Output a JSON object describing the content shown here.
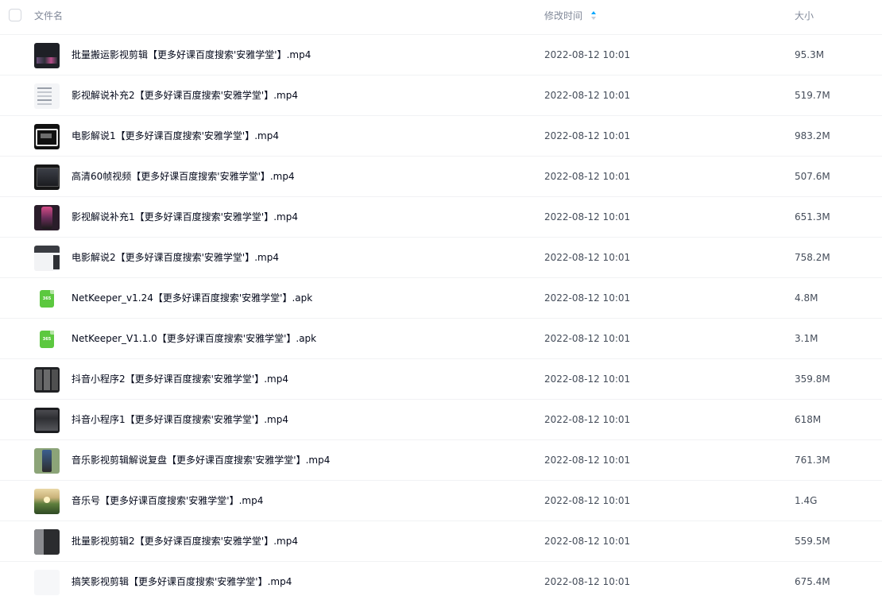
{
  "header": {
    "name_label": "文件名",
    "mtime_label": "修改时间",
    "size_label": "大小"
  },
  "files": [
    {
      "name": "批量搬运影视剪辑【更多好课百度搜索'安雅学堂'】.mp4",
      "mtime": "2022-08-12 10:01",
      "size": "95.3M",
      "type": "video"
    },
    {
      "name": "影视解说补充2【更多好课百度搜索'安雅学堂'】.mp4",
      "mtime": "2022-08-12 10:01",
      "size": "519.7M",
      "type": "video"
    },
    {
      "name": "电影解说1【更多好课百度搜索'安雅学堂'】.mp4",
      "mtime": "2022-08-12 10:01",
      "size": "983.2M",
      "type": "video"
    },
    {
      "name": "高清60帧视频【更多好课百度搜索'安雅学堂'】.mp4",
      "mtime": "2022-08-12 10:01",
      "size": "507.6M",
      "type": "video"
    },
    {
      "name": "影视解说补充1【更多好课百度搜索'安雅学堂'】.mp4",
      "mtime": "2022-08-12 10:01",
      "size": "651.3M",
      "type": "video"
    },
    {
      "name": "电影解说2【更多好课百度搜索'安雅学堂'】.mp4",
      "mtime": "2022-08-12 10:01",
      "size": "758.2M",
      "type": "video"
    },
    {
      "name": "NetKeeper_v1.24【更多好课百度搜索'安雅学堂'】.apk",
      "mtime": "2022-08-12 10:01",
      "size": "4.8M",
      "type": "apk"
    },
    {
      "name": "NetKeeper_V1.1.0【更多好课百度搜索'安雅学堂'】.apk",
      "mtime": "2022-08-12 10:01",
      "size": "3.1M",
      "type": "apk"
    },
    {
      "name": "抖音小程序2【更多好课百度搜索'安雅学堂'】.mp4",
      "mtime": "2022-08-12 10:01",
      "size": "359.8M",
      "type": "video"
    },
    {
      "name": "抖音小程序1【更多好课百度搜索'安雅学堂'】.mp4",
      "mtime": "2022-08-12 10:01",
      "size": "618M",
      "type": "video"
    },
    {
      "name": "音乐影视剪辑解说复盘【更多好课百度搜索'安雅学堂'】.mp4",
      "mtime": "2022-08-12 10:01",
      "size": "761.3M",
      "type": "video"
    },
    {
      "name": "音乐号【更多好课百度搜索'安雅学堂'】.mp4",
      "mtime": "2022-08-12 10:01",
      "size": "1.4G",
      "type": "video"
    },
    {
      "name": "批量影视剪辑2【更多好课百度搜索'安雅学堂'】.mp4",
      "mtime": "2022-08-12 10:01",
      "size": "559.5M",
      "type": "video"
    },
    {
      "name": "搞笑影视剪辑【更多好课百度搜索'安雅学堂'】.mp4",
      "mtime": "2022-08-12 10:01",
      "size": "675.4M",
      "type": "video"
    }
  ],
  "colors": {
    "sort_arrow_active": "#06a7ff",
    "sort_arrow_inactive": "#c7ccd6",
    "apk_green": "#5cc83f",
    "row_border": "#f1f2f4"
  },
  "icons": {
    "apk": "apk-file-icon",
    "sort": "sort-icon"
  }
}
